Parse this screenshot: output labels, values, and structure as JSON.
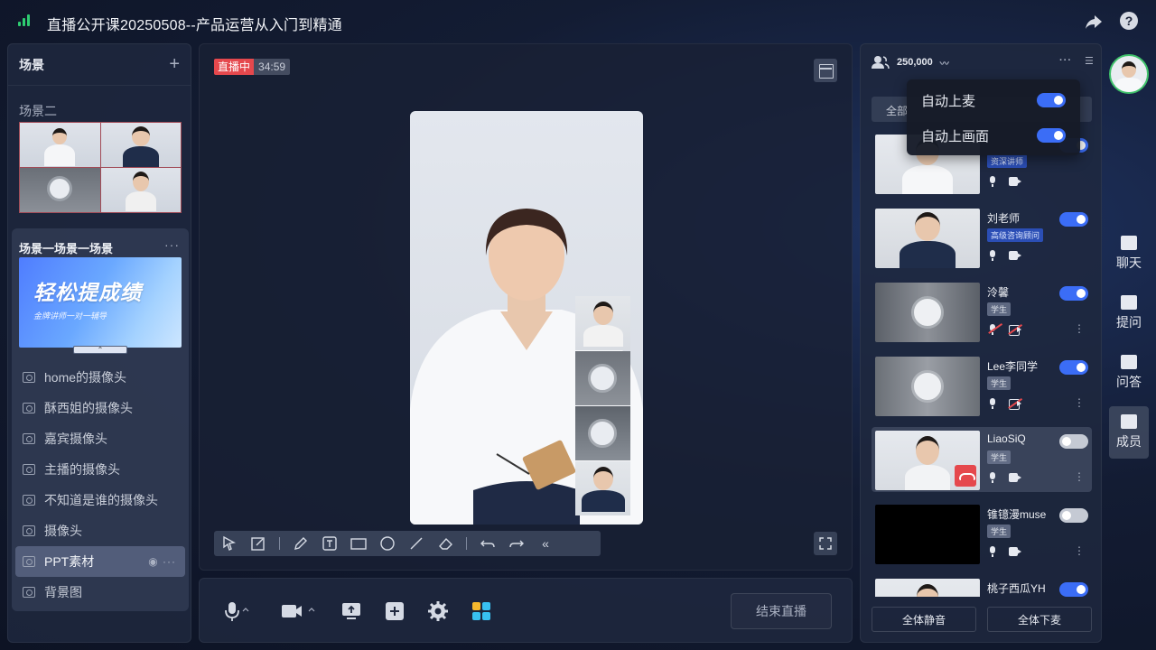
{
  "window": {
    "title": "直播公开课20250508--产品运营从入门到精通"
  },
  "scenes_panel": {
    "title": "场景",
    "add_label": "+",
    "scene2_label": "场景二",
    "scene1_label": "场景一场景一场景",
    "scene1_more": "···",
    "banner": {
      "headline": "轻松提成绩",
      "subline": "金牌讲师一对一辅导"
    },
    "sources": [
      {
        "label": "home的摄像头",
        "icon": "camera-icon"
      },
      {
        "label": "酥西姐的摄像头",
        "icon": "camera-icon"
      },
      {
        "label": "嘉宾摄像头",
        "icon": "camera-icon"
      },
      {
        "label": "主播的摄像头",
        "icon": "camera-icon"
      },
      {
        "label": "不知道是谁的摄像头",
        "icon": "camera-icon"
      },
      {
        "label": "摄像头",
        "icon": "camera-icon"
      },
      {
        "label": "PPT素材",
        "icon": "presentation-icon",
        "active": true
      },
      {
        "label": "背景图",
        "icon": "image-icon"
      }
    ]
  },
  "stage": {
    "live_label": "直播中",
    "elapsed": "34:59"
  },
  "controls": {
    "end_label": "结束直播"
  },
  "members": {
    "count": "250,000",
    "filter_all": "全部",
    "popover": {
      "auto_mic_label": "自动上麦",
      "auto_mic_on": true,
      "auto_screen_label": "自动上画面",
      "auto_screen_on": true
    },
    "list": [
      {
        "name": "",
        "role": "资深讲师",
        "role_style": "blue",
        "on": true
      },
      {
        "name": "刘老师",
        "role": "高级咨询顾问",
        "role_style": "blue",
        "on": true
      },
      {
        "name": "泠馨",
        "role": "学生",
        "on": true
      },
      {
        "name": "Lee李同学",
        "role": "学生",
        "on": true
      },
      {
        "name": "LiaoSiQ",
        "role": "学生",
        "on": false
      },
      {
        "name": "锥镱漫muse",
        "role": "学生",
        "on": false
      },
      {
        "name": "桃子西瓜YH",
        "role": "",
        "on": true
      }
    ],
    "mute_all": "全体静音",
    "all_off_mic": "全体下麦"
  },
  "rail": {
    "chat": "聊天",
    "ask": "提问",
    "qa": "问答",
    "members": "成员"
  },
  "colors": {
    "accent": "#3b6df6",
    "live": "#e5484d",
    "online": "#3fc16a"
  }
}
